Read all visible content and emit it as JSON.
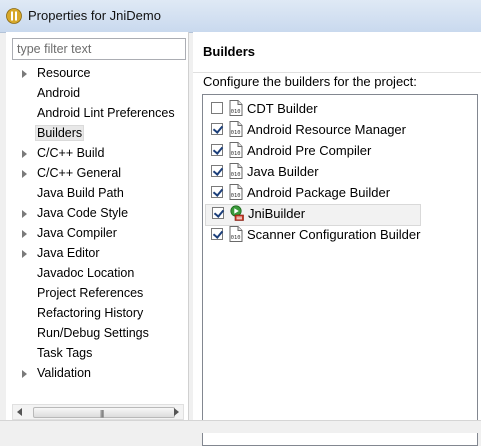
{
  "window": {
    "title": "Properties for JniDemo"
  },
  "filter": {
    "placeholder": "type filter text"
  },
  "tree": {
    "items": [
      {
        "label": "Resource",
        "expandable": true
      },
      {
        "label": "Android",
        "expandable": false
      },
      {
        "label": "Android Lint Preferences",
        "expandable": false
      },
      {
        "label": "Builders",
        "expandable": false,
        "selected": true
      },
      {
        "label": "C/C++ Build",
        "expandable": true
      },
      {
        "label": "C/C++ General",
        "expandable": true
      },
      {
        "label": "Java Build Path",
        "expandable": false
      },
      {
        "label": "Java Code Style",
        "expandable": true
      },
      {
        "label": "Java Compiler",
        "expandable": true
      },
      {
        "label": "Java Editor",
        "expandable": true
      },
      {
        "label": "Javadoc Location",
        "expandable": false
      },
      {
        "label": "Project References",
        "expandable": false
      },
      {
        "label": "Refactoring History",
        "expandable": false
      },
      {
        "label": "Run/Debug Settings",
        "expandable": false
      },
      {
        "label": "Task Tags",
        "expandable": false
      },
      {
        "label": "Validation",
        "expandable": true
      }
    ]
  },
  "page": {
    "heading": "Builders",
    "description": "Configure the builders for the project:"
  },
  "builders": [
    {
      "name": "CDT Builder",
      "checked": false,
      "icon": "builder-binary-icon"
    },
    {
      "name": "Android Resource Manager",
      "checked": true,
      "icon": "builder-binary-icon"
    },
    {
      "name": "Android Pre Compiler",
      "checked": true,
      "icon": "builder-binary-icon"
    },
    {
      "name": "Java Builder",
      "checked": true,
      "icon": "builder-binary-icon"
    },
    {
      "name": "Android Package Builder",
      "checked": true,
      "icon": "builder-binary-icon"
    },
    {
      "name": "JniBuilder",
      "checked": true,
      "icon": "external-tool-builder-icon",
      "selected": true
    },
    {
      "name": "Scanner Configuration Builder",
      "checked": true,
      "icon": "builder-binary-icon"
    }
  ],
  "colors": {
    "titlebar": "#c9d9ee",
    "selection": "#e8e8e8",
    "check": "#1c3f7a"
  }
}
